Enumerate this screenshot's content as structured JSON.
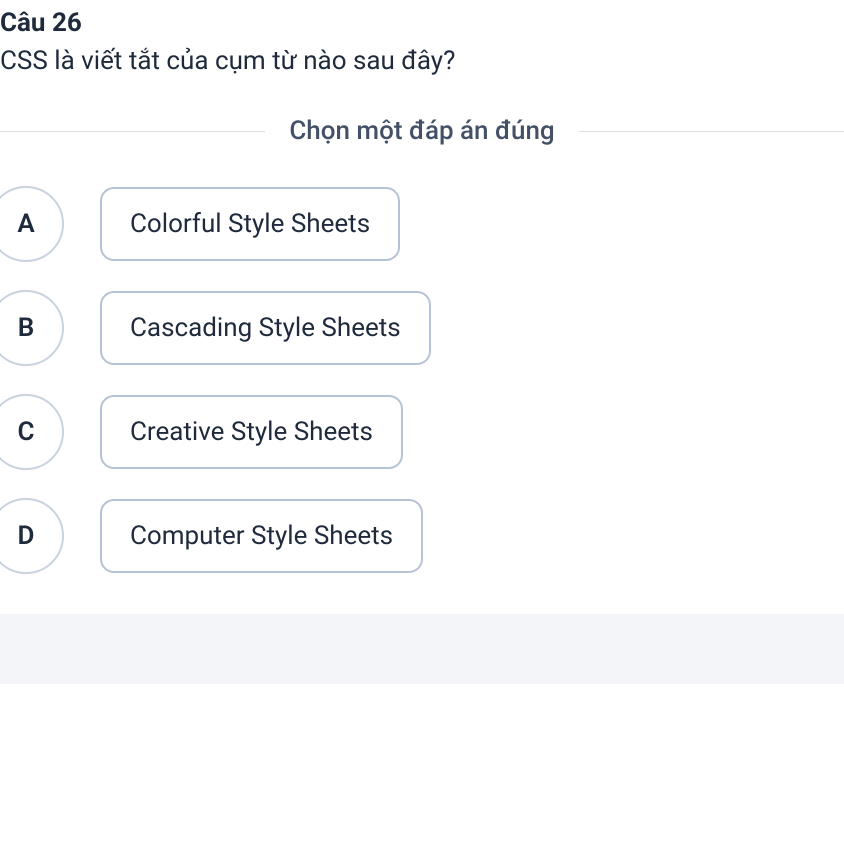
{
  "question": {
    "number_label": "Câu 26",
    "text": "CSS là viết tắt của cụm từ nào sau đây?"
  },
  "instruction": "Chọn một đáp án đúng",
  "options": [
    {
      "letter": "A",
      "text": "Colorful Style Sheets"
    },
    {
      "letter": "B",
      "text": "Cascading Style Sheets"
    },
    {
      "letter": "C",
      "text": "Creative Style Sheets"
    },
    {
      "letter": "D",
      "text": "Computer Style Sheets"
    }
  ]
}
